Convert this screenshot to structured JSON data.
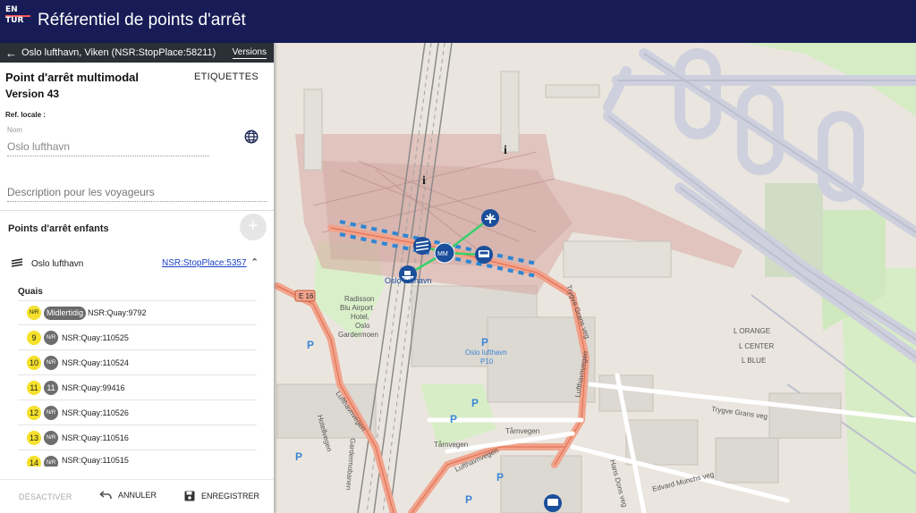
{
  "header": {
    "logo_text": "EN TUR",
    "logo_line1": "EN",
    "logo_line2": "TUR",
    "title": "Référentiel de points d'arrêt",
    "bg_color": "#181c56",
    "accent_color": "#ff5959"
  },
  "panel": {
    "place_name": "Oslo lufthavn, Viken (NSR:StopPlace:58211)",
    "versions_label": "Versions",
    "title": "Point d'arrêt multimodal",
    "version": "Version 43",
    "tags_label": "ETIQUETTES",
    "local_ref_label": "Ref. locale :",
    "name_label": "Nom",
    "name_value": "Oslo lufthavn",
    "description_placeholder": "Description pour les voyageurs",
    "children_title": "Points d'arrêt enfants",
    "add_label": "+",
    "child": {
      "name": "Oslo lufthavn",
      "id": "NSR:StopPlace:5357",
      "icon": "train-icon"
    },
    "quais_title": "Quais",
    "quays": [
      {
        "public_code": "N/R",
        "private_code": "Midlertidig",
        "id": "NSR:Quay:9792"
      },
      {
        "public_code": "9",
        "private_code": "N/R",
        "id": "NSR:Quay:110525"
      },
      {
        "public_code": "10",
        "private_code": "N/R",
        "id": "NSR:Quay:110524"
      },
      {
        "public_code": "11",
        "private_code": "11",
        "id": "NSR:Quay:99416"
      },
      {
        "public_code": "12",
        "private_code": "N/R",
        "id": "NSR:Quay:110526"
      },
      {
        "public_code": "13",
        "private_code": "N/R",
        "id": "NSR:Quay:110516"
      },
      {
        "public_code": "14",
        "private_code": "N/R",
        "id": "NSR:Quay:110515"
      }
    ],
    "footer": {
      "deactivate_label": "DÉSACTIVER",
      "undo_label": "ANNULER",
      "save_label": "ENREGISTRER"
    }
  },
  "map": {
    "labels": {
      "oslo_lufthavn": "Oslo lufthavn",
      "multimodal_badge": "MM",
      "radisson_1": "Radisson",
      "radisson_2": "Blu Airport",
      "radisson_3": "Hotel,",
      "radisson_4": "Oslo",
      "radisson_5": "Gardermoen",
      "parking_name": "Oslo lufthavn",
      "parking_code": "P10",
      "road_e16": "E 16",
      "road_lufthavnvegen": "Lufthavnvegen",
      "road_tarnvegen": "Tårnvegen",
      "road_trygve": "Trygve Grans veg",
      "road_edvard": "Edvard Munchs veg",
      "road_hans": "Hans Dons veg",
      "road_hotellvegen": "Hotellvegen",
      "road_gardermobanen": "Gardermobanen",
      "lot_orange": "L ORANGE",
      "lot_center": "L CENTER",
      "lot_blue": "L BLUE",
      "parking_letter": "P",
      "info_letter": "i"
    },
    "icons": [
      "airplane-icon",
      "bus-icon",
      "train-icon",
      "ferry-icon",
      "multimodal-icon"
    ]
  }
}
